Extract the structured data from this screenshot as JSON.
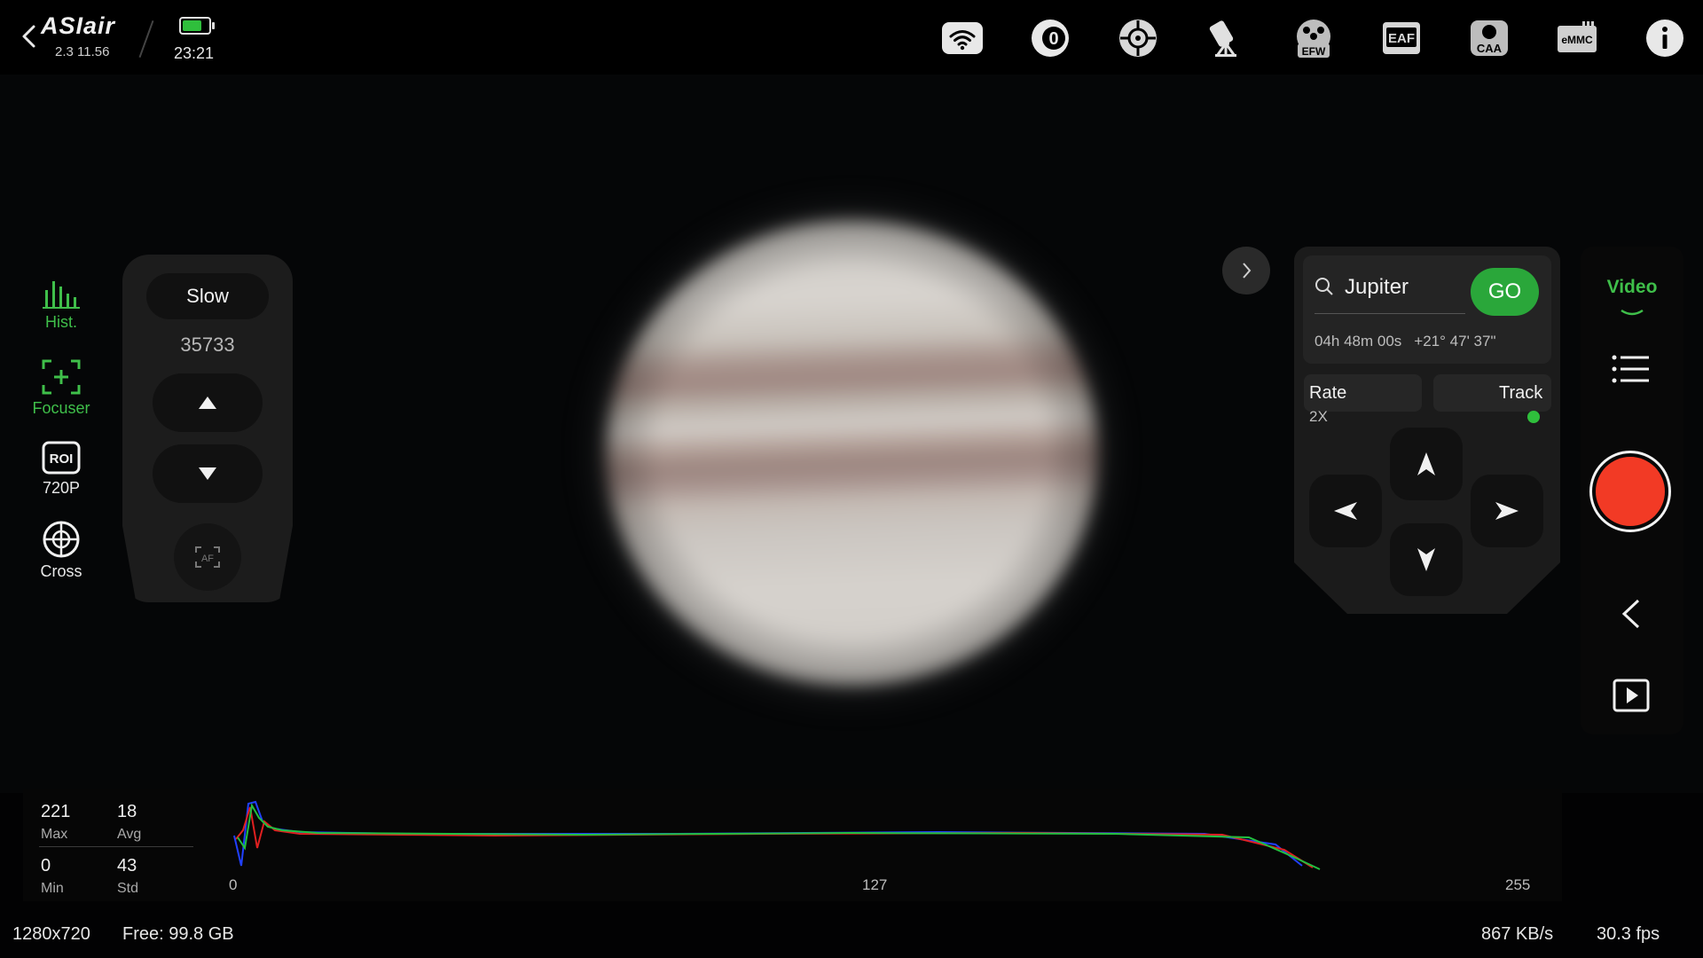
{
  "app": {
    "logo": "ASIair",
    "version": "2.3 11.56",
    "clock": "23:21",
    "battery_level": 0.75
  },
  "top_icons": [
    {
      "name": "wifi-icon"
    },
    {
      "name": "camera-zero-icon",
      "text": "0"
    },
    {
      "name": "guide-camera-icon"
    },
    {
      "name": "telescope-mount-icon"
    },
    {
      "name": "efw-icon",
      "text": "EFW"
    },
    {
      "name": "eaf-icon",
      "text": "EAF"
    },
    {
      "name": "caa-icon",
      "text": "CAA"
    },
    {
      "name": "emmc-icon",
      "text": "eMMC"
    },
    {
      "name": "info-icon"
    }
  ],
  "left_tools": {
    "hist": {
      "label": "Hist.",
      "active": true
    },
    "focuser": {
      "label": "Focuser",
      "active": true
    },
    "roi": {
      "badge": "ROI",
      "label": "720P"
    },
    "cross": {
      "label": "Cross"
    }
  },
  "focuser": {
    "speed": "Slow",
    "position": "35733",
    "af_label": "AF"
  },
  "mount": {
    "target": "Jupiter",
    "go_label": "GO",
    "ra": "04h 48m 00s",
    "dec": "+21° 47' 37\"",
    "rate_label": "Rate",
    "rate_value": "2X",
    "track_label": "Track",
    "track_on": true
  },
  "right_panel": {
    "mode": "Video"
  },
  "histogram": {
    "max_value": "221",
    "max_label": "Max",
    "avg_value": "18",
    "avg_label": "Avg",
    "min_value": "0",
    "min_label": "Min",
    "std_value": "43",
    "std_label": "Std",
    "ticks": [
      "0",
      "127",
      "255"
    ]
  },
  "status": {
    "resolution": "1280x720",
    "free": "Free: 99.8 GB",
    "bitrate": "867 KB/s",
    "fps": "30.3 fps"
  },
  "colors": {
    "accent_green": "#3fbf4a",
    "go_green": "#2aa73a",
    "record_red": "#f23a25",
    "hist_red": "#e02020",
    "hist_green": "#22c040",
    "hist_blue": "#2040ff"
  }
}
